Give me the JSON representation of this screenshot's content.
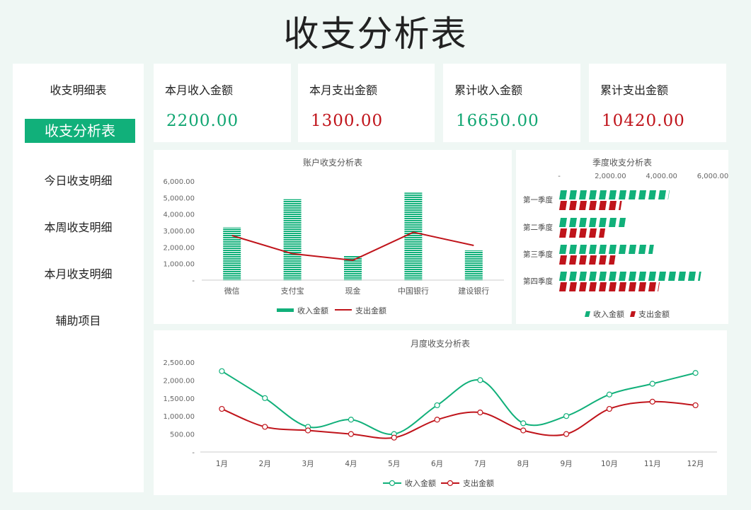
{
  "title": "收支分析表",
  "sidebar": {
    "items": [
      {
        "label": "收支明细表",
        "active": false
      },
      {
        "label": "收支分析表",
        "active": true
      },
      {
        "label": "今日收支明细",
        "active": false
      },
      {
        "label": "本周收支明细",
        "active": false
      },
      {
        "label": "本月收支明细",
        "active": false
      },
      {
        "label": "辅助项目",
        "active": false
      }
    ]
  },
  "kpis": [
    {
      "label": "本月收入金额",
      "value": "2200.00",
      "color": "#11a672"
    },
    {
      "label": "本月支出金额",
      "value": "1300.00",
      "color": "#c0141b"
    },
    {
      "label": "累计收入金额",
      "value": "16650.00",
      "color": "#11a672"
    },
    {
      "label": "累计支出金额",
      "value": "10420.00",
      "color": "#c0141b"
    }
  ],
  "colors": {
    "income": "#11b07a",
    "expense": "#c0141b",
    "accent": "#11b07a"
  },
  "chart_data": [
    {
      "type": "bar",
      "title": "账户收支分析表",
      "categories": [
        "微信",
        "支付宝",
        "现金",
        "中国银行",
        "建设银行"
      ],
      "series": [
        {
          "name": "收入金额",
          "type": "bar",
          "values": [
            3200,
            4900,
            1500,
            5300,
            1800
          ]
        },
        {
          "name": "支出金额",
          "type": "line",
          "values": [
            2700,
            1600,
            1200,
            2900,
            2100
          ]
        }
      ],
      "yticks": [
        "6,000.00",
        "5,000.00",
        "4,000.00",
        "3,000.00",
        "2,000.00",
        "1,000.00",
        "-"
      ],
      "ylim": [
        0,
        6000
      ],
      "legend": "bottom"
    },
    {
      "type": "bar",
      "orientation": "horizontal",
      "title": "季度收支分析表",
      "categories": [
        "第一季度",
        "第二季度",
        "第三季度",
        "第四季度"
      ],
      "series": [
        {
          "name": "收入金额",
          "values": [
            4300,
            2600,
            3700,
            5550
          ]
        },
        {
          "name": "支出金额",
          "values": [
            2450,
            1800,
            2200,
            3900
          ]
        }
      ],
      "xticks": [
        "-",
        "2,000.00",
        "4,000.00",
        "6,000.00"
      ],
      "xlim": [
        0,
        6000
      ],
      "legend": "bottom"
    },
    {
      "type": "line",
      "title": "月度收支分析表",
      "categories": [
        "1月",
        "2月",
        "3月",
        "4月",
        "5月",
        "6月",
        "7月",
        "8月",
        "9月",
        "10月",
        "11月",
        "12月"
      ],
      "series": [
        {
          "name": "收入金额",
          "values": [
            2250,
            1500,
            700,
            900,
            500,
            1300,
            2000,
            800,
            1000,
            1600,
            1900,
            2200
          ]
        },
        {
          "name": "支出金额",
          "values": [
            1200,
            700,
            600,
            500,
            400,
            900,
            1100,
            600,
            500,
            1200,
            1400,
            1300
          ]
        }
      ],
      "yticks": [
        "2,500.00",
        "2,000.00",
        "1,500.00",
        "1,000.00",
        "500.00",
        "-"
      ],
      "ylim": [
        0,
        2500
      ],
      "smooth": true,
      "legend": "bottom"
    }
  ]
}
